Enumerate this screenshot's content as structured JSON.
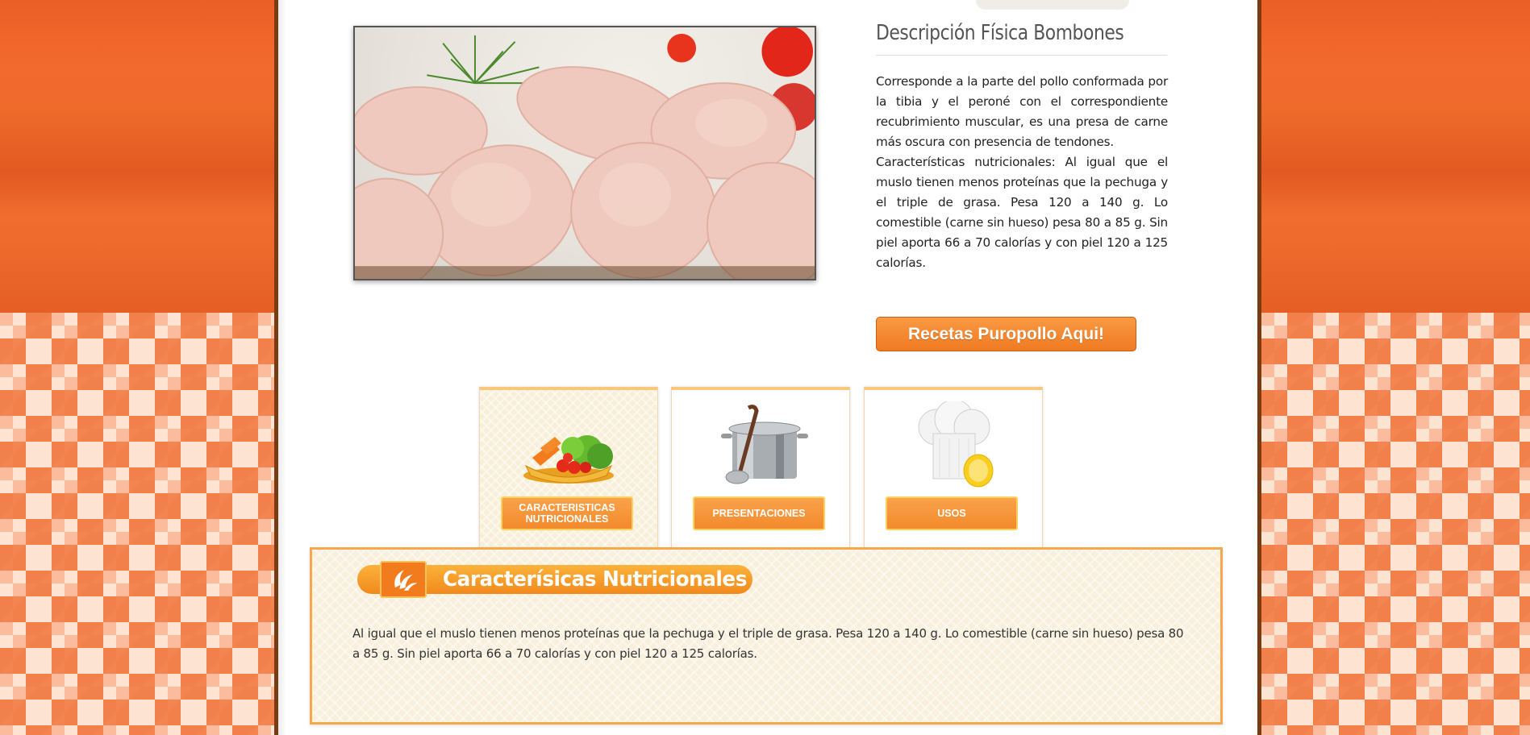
{
  "description": {
    "title": "Descripción Física Bombones",
    "paragraph1": "Corresponde a la parte del pollo conformada por la tibia y el peroné con el correspondiente recubrimiento muscular, es una presa de carne más oscura con presencia de tendones.",
    "paragraph2": "Características nutricionales: Al igual que el muslo tienen menos proteínas que la pechuga y el triple de grasa. Pesa 120 a 140 g. Lo comestible (carne sin hueso) pesa 80 a 85 g. Sin piel aporta 66 a 70 calorías y  con piel 120 a 125 calorías."
  },
  "cta": {
    "label": "Recetas Puropollo Aqui!"
  },
  "tabs": [
    {
      "label": "CARACTERISTICAS NUTRICIONALES",
      "icon": "vegetables-icon",
      "active": true
    },
    {
      "label": "PRESENTACIONES",
      "icon": "cooking-pot-icon",
      "active": false
    },
    {
      "label": "USOS",
      "icon": "chef-hat-icon",
      "active": false
    }
  ],
  "panel": {
    "title": "Caracterísicas Nutricionales",
    "text": "Al igual que el muslo tienen menos proteínas que la pechuga y el triple de grasa. Pesa 120 a 140 g. Lo comestible (carne sin hueso) pesa 80 a 85 g. Sin piel aporta 66 a 70 calorías y  con piel 120 a 125 calorías."
  },
  "colors": {
    "accent": "#f28a2c",
    "page_border": "#7a3b12",
    "panel_bg": "#f8f0dc"
  }
}
